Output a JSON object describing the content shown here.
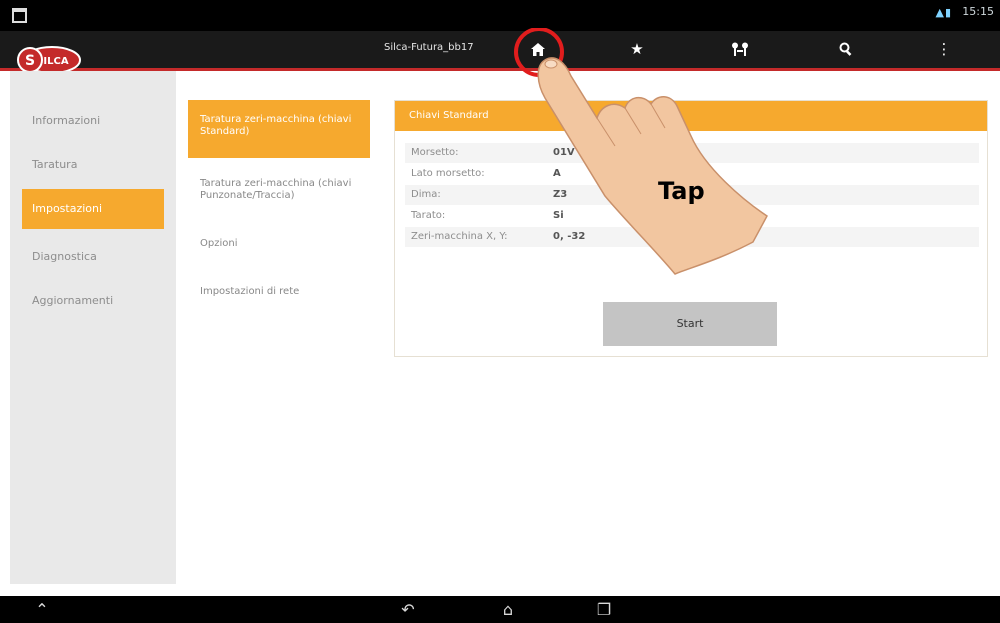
{
  "statusbar": {
    "time": "15:15",
    "icons": "wifi-icon battery-icon"
  },
  "actionbar": {
    "device_name": "Silca-Futura_bb17",
    "logo_text": "SILCA",
    "icons": [
      "home-icon",
      "star-icon",
      "keys-icon",
      "search-icon",
      "overflow-menu-icon"
    ]
  },
  "sidebar": {
    "items": [
      {
        "label": "Informazioni",
        "active": false
      },
      {
        "label": "Taratura",
        "active": false
      },
      {
        "label": "Impostazioni",
        "active": true
      },
      {
        "label": "Diagnostica",
        "active": false
      },
      {
        "label": "Aggiornamenti",
        "active": false
      }
    ]
  },
  "subnav": {
    "items": [
      {
        "label": "Taratura zeri-macchina (chiavi Standard)",
        "active": true
      },
      {
        "label": "Taratura zeri-macchina (chiavi Punzonate/Traccia)",
        "active": false
      },
      {
        "label": "Opzioni",
        "active": false
      },
      {
        "label": "Impostazioni di rete",
        "active": false
      }
    ]
  },
  "card": {
    "title": "Chiavi Standard",
    "rows": [
      {
        "label": "Morsetto:",
        "value": "01V"
      },
      {
        "label": "Lato morsetto:",
        "value": "A"
      },
      {
        "label": "Dima:",
        "value": "Z3"
      },
      {
        "label": "Tarato:",
        "value": "Si"
      },
      {
        "label": "Zeri-macchina X, Y:",
        "value": "0, -32"
      }
    ],
    "start_label": "Start"
  },
  "annotation": {
    "tap_label": "Tap"
  },
  "navbar": {
    "icons": [
      "collapse-icon",
      "back-icon",
      "home-icon",
      "recent-apps-icon"
    ]
  },
  "colors": {
    "accent": "#f6a92e",
    "brand_red": "#c42a2a",
    "actionbar": "#1a1a1a"
  }
}
